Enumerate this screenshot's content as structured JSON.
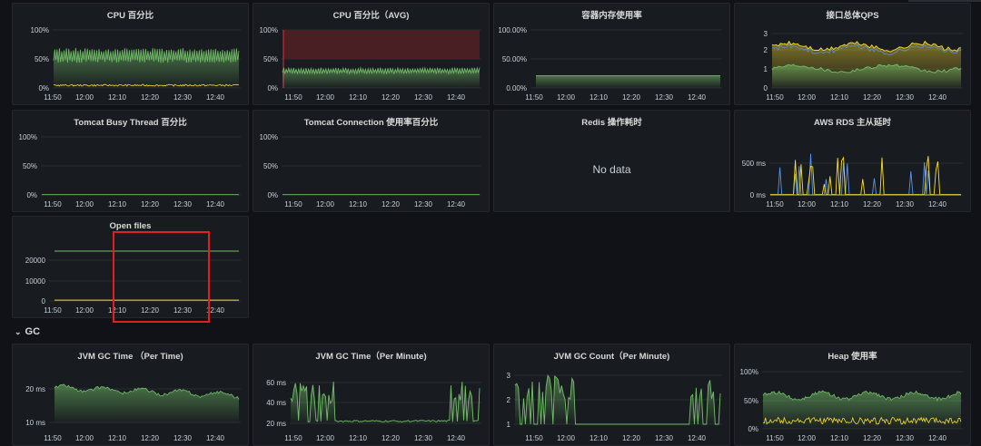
{
  "colors": {
    "green": "#73bf69",
    "yellow": "#fade2a",
    "blue": "#5794f2",
    "orange": "#ff780a",
    "red": "#e02f44",
    "panel_bg": "#181b1f",
    "page_bg": "#111217"
  },
  "row": {
    "title": "GC",
    "collapse_icon": "chevron-down-icon"
  },
  "no_data_text": "No data",
  "panels": [
    {
      "title": "CPU 百分比",
      "y_ticks": [
        "100%",
        "50%",
        "0%"
      ],
      "x_ticks": [
        "11:50",
        "12:00",
        "12:10",
        "12:20",
        "12:30",
        "12:40"
      ]
    },
    {
      "title": "CPU 百分比（AVG)",
      "y_ticks": [
        "100%",
        "50%",
        "0%"
      ],
      "x_ticks": [
        "11:50",
        "12:00",
        "12:10",
        "12:20",
        "12:30",
        "12:40"
      ]
    },
    {
      "title": "容器内存使用率",
      "y_ticks": [
        "100.00%",
        "50.00%",
        "0.00%"
      ],
      "x_ticks": [
        "11:50",
        "12:00",
        "12:10",
        "12:20",
        "12:30",
        "12:40"
      ]
    },
    {
      "title": "接口总体QPS",
      "y_ticks": [
        "3",
        "2",
        "1",
        "0"
      ],
      "x_ticks": [
        "11:50",
        "12:00",
        "12:10",
        "12:20",
        "12:30",
        "12:40"
      ]
    },
    {
      "title": "Tomcat Busy Thread 百分比",
      "y_ticks": [
        "100%",
        "50%",
        "0%"
      ],
      "x_ticks": [
        "11:50",
        "12:00",
        "12:10",
        "12:20",
        "12:30",
        "12:40"
      ]
    },
    {
      "title": "Tomcat Connection 使用率百分比",
      "y_ticks": [
        "100%",
        "50%",
        "0%"
      ],
      "x_ticks": [
        "11:50",
        "12:00",
        "12:10",
        "12:20",
        "12:30",
        "12:40"
      ]
    },
    {
      "title": "Redis 操作耗时",
      "y_ticks": [],
      "x_ticks": []
    },
    {
      "title": "AWS RDS 主从延时",
      "y_ticks": [
        "500 ms",
        "0 ms"
      ],
      "x_ticks": [
        "11:50",
        "12:00",
        "12:10",
        "12:20",
        "12:30",
        "12:40"
      ]
    },
    {
      "title": "Open files",
      "y_ticks": [
        "20000",
        "10000",
        "0"
      ],
      "x_ticks": [
        "11:50",
        "12:00",
        "12:10",
        "12:20",
        "12:30",
        "12:40"
      ]
    },
    {
      "title": "JVM GC Time （Per Time)",
      "y_ticks": [
        "20 ms",
        "10 ms"
      ],
      "x_ticks": [
        "11:50",
        "12:00",
        "12:10",
        "12:20",
        "12:30",
        "12:40"
      ]
    },
    {
      "title": "JVM GC Time（Per Minute)",
      "y_ticks": [
        "60 ms",
        "40 ms",
        "20 ms"
      ],
      "x_ticks": [
        "11:50",
        "12:00",
        "12:10",
        "12:20",
        "12:30",
        "12:40"
      ]
    },
    {
      "title": "JVM GC Count（Per Minute)",
      "y_ticks": [
        "3",
        "2",
        "1"
      ],
      "x_ticks": [
        "11:50",
        "12:00",
        "12:10",
        "12:20",
        "12:30",
        "12:40"
      ]
    },
    {
      "title": "Heap 使用率",
      "y_ticks": [
        "100%",
        "50%",
        "0%"
      ],
      "x_ticks": [
        "11:50",
        "12:00",
        "12:10",
        "12:20",
        "12:30",
        "12:40"
      ]
    }
  ]
}
